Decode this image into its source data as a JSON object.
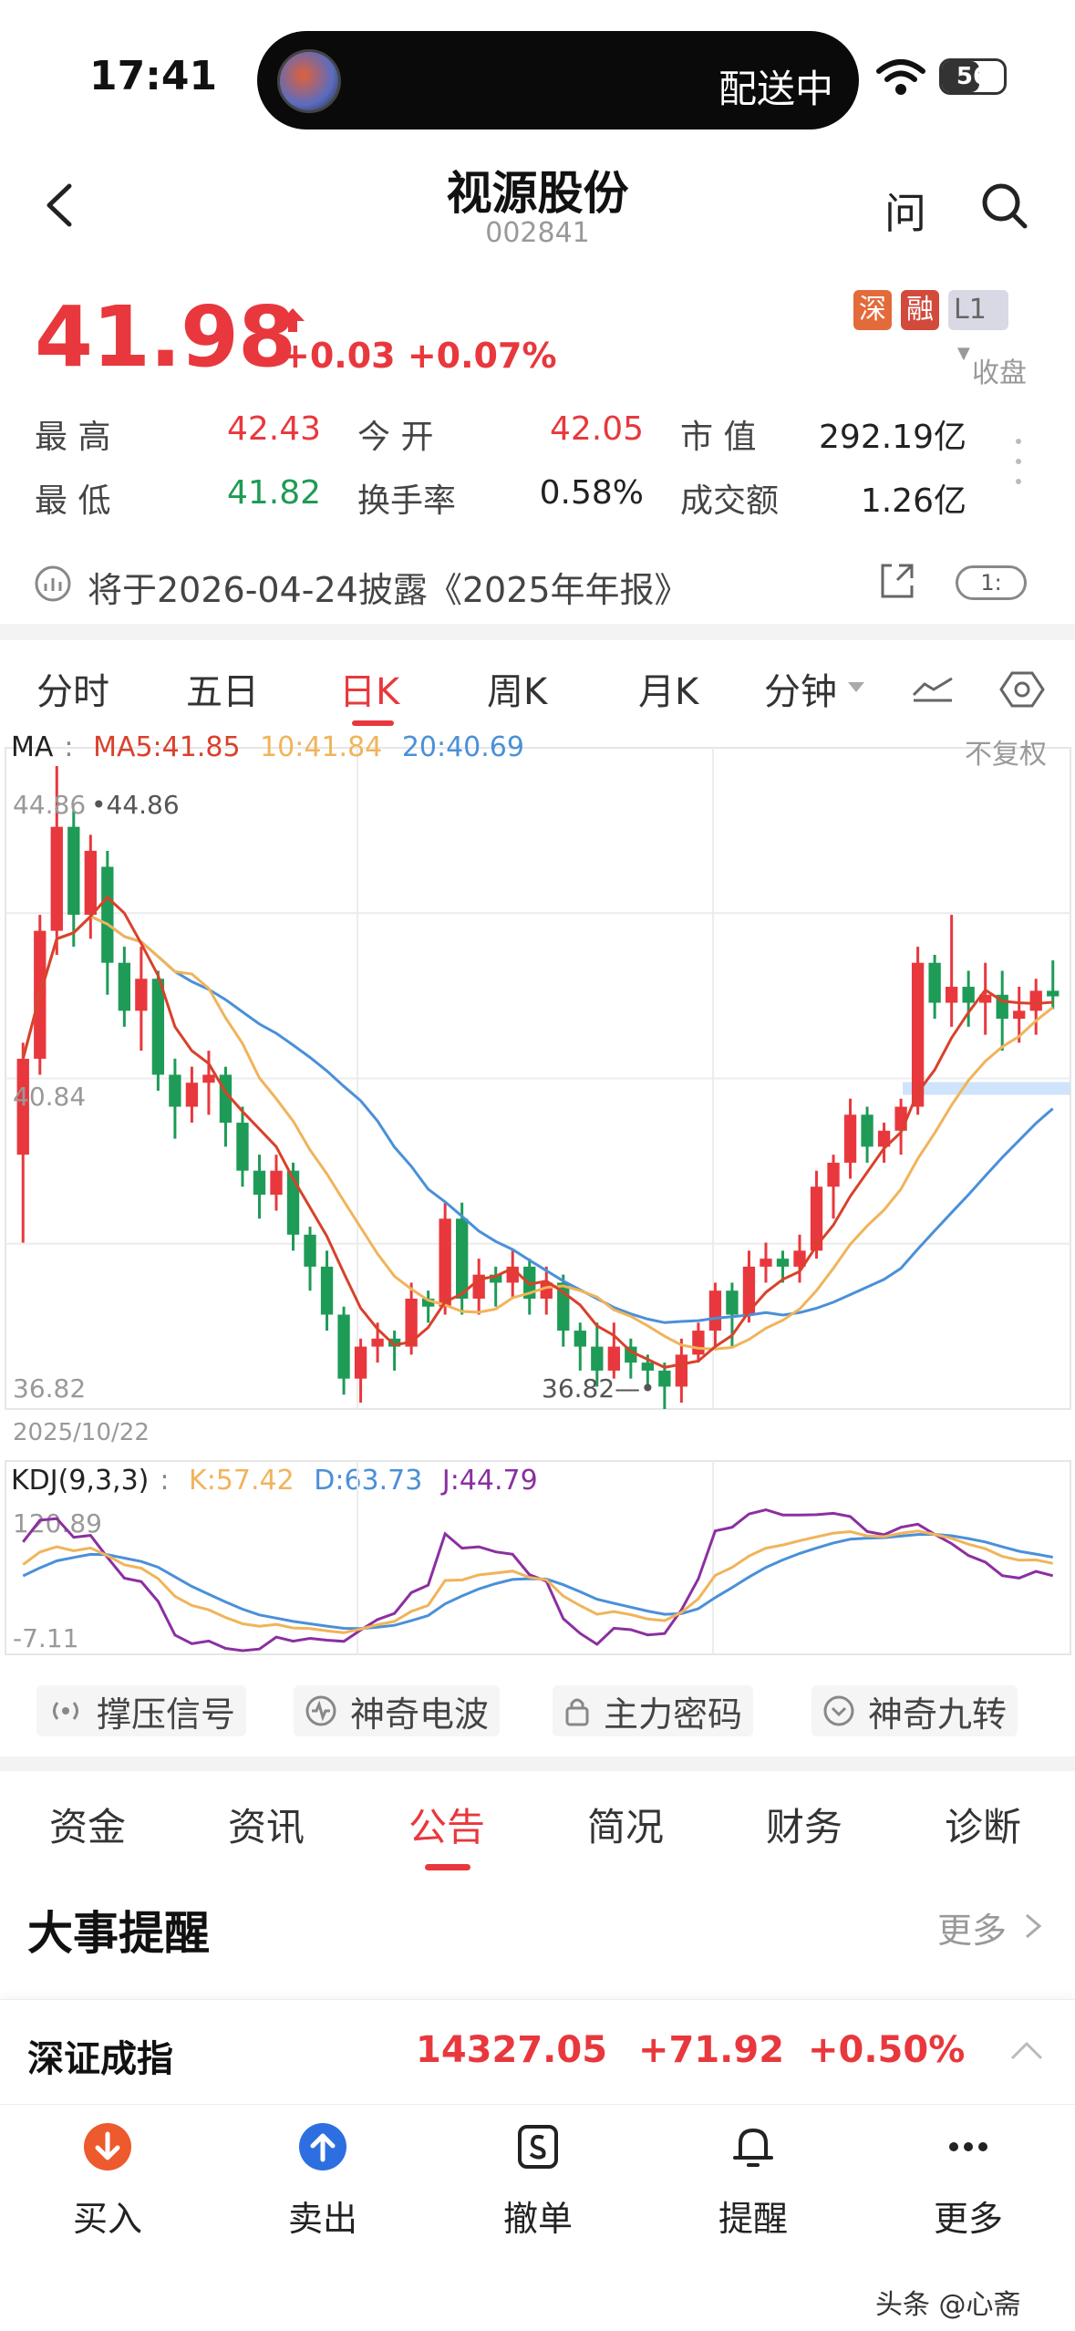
{
  "status": {
    "time": "17:41",
    "island_text": "配送中",
    "battery": "56"
  },
  "header": {
    "title": "视源股份",
    "code": "002841",
    "ask": "问"
  },
  "quote": {
    "price": "41.98",
    "change": "+0.03",
    "change_pct": "+0.07%",
    "tags": [
      "深",
      "融",
      "L1"
    ],
    "status": "收盘"
  },
  "stats": {
    "high_label": "最  高",
    "high": "42.43",
    "open_label": "今  开",
    "open": "42.05",
    "mcap_label": "市  值",
    "mcap": "292.19亿",
    "low_label": "最  低",
    "low": "41.82",
    "turnover_label": "换手率",
    "turnover": "0.58%",
    "amount_label": "成交额",
    "amount": "1.26亿"
  },
  "notice": {
    "text": "将于2026-04-24披露《2025年年报》",
    "badge": "1:"
  },
  "chart_tabs": [
    "分时",
    "五日",
    "日K",
    "周K",
    "月K",
    "分钟"
  ],
  "ma": {
    "label": "MA",
    "ma5": "MA5:41.85",
    "ma10": "10:41.84",
    "ma20": "20:40.69",
    "adjust": "不复权"
  },
  "axis": {
    "top": "44.86",
    "mid": "40.84",
    "bottom": "36.82",
    "max_mark": "44.86",
    "min_mark": "36.82"
  },
  "date": "2025/10/22",
  "kdj": {
    "label": "KDJ(9,3,3)",
    "k": "K:57.42",
    "d": "D:63.73",
    "j": "J:44.79",
    "top": "120.89",
    "bottom": "-7.11"
  },
  "indicators": [
    "撑压信号",
    "神奇电波",
    "主力密码",
    "神奇九转"
  ],
  "bottom_tabs": [
    "资金",
    "资讯",
    "公告",
    "简况",
    "财务",
    "诊断"
  ],
  "events": {
    "title": "大事提醒",
    "more": "更多"
  },
  "index": {
    "name": "深证成指",
    "value": "14327.05",
    "change": "+71.92",
    "pct": "+0.50%"
  },
  "nav": [
    "买入",
    "卖出",
    "撤单",
    "提醒",
    "更多"
  ],
  "watermark": "头条 @心斋",
  "colors": {
    "up": "#e8383d",
    "down": "#1e9b56",
    "ma5": "#d9412b",
    "ma10": "#f0b45a",
    "ma20": "#4a90d9",
    "kdj_j": "#8b2fa0"
  },
  "chart_data": {
    "type": "candlestick",
    "ylim": [
      36.82,
      44.86
    ],
    "candles": [
      [
        40.0,
        41.2,
        38.9,
        41.4
      ],
      [
        41.2,
        42.8,
        41.0,
        43.0
      ],
      [
        42.8,
        44.1,
        42.5,
        44.86
      ],
      [
        44.1,
        43.0,
        42.6,
        44.3
      ],
      [
        43.0,
        43.8,
        42.7,
        44.0
      ],
      [
        43.6,
        42.4,
        42.0,
        43.8
      ],
      [
        42.4,
        41.8,
        41.6,
        42.6
      ],
      [
        41.8,
        42.2,
        41.3,
        42.6
      ],
      [
        42.2,
        41.0,
        40.8,
        42.3
      ],
      [
        41.0,
        40.6,
        40.2,
        41.2
      ],
      [
        40.6,
        40.9,
        40.4,
        41.1
      ],
      [
        40.9,
        41.0,
        40.5,
        41.3
      ],
      [
        41.0,
        40.4,
        40.1,
        41.1
      ],
      [
        40.4,
        39.8,
        39.6,
        40.6
      ],
      [
        39.8,
        39.5,
        39.2,
        40.0
      ],
      [
        39.5,
        39.8,
        39.3,
        40.0
      ],
      [
        39.8,
        39.0,
        38.8,
        39.9
      ],
      [
        39.0,
        38.6,
        38.3,
        39.1
      ],
      [
        38.6,
        38.0,
        37.8,
        38.8
      ],
      [
        38.0,
        37.2,
        37.0,
        38.1
      ],
      [
        37.2,
        37.6,
        36.9,
        37.7
      ],
      [
        37.6,
        37.7,
        37.4,
        37.9
      ],
      [
        37.7,
        37.6,
        37.3,
        37.8
      ],
      [
        37.6,
        38.2,
        37.5,
        38.4
      ],
      [
        38.2,
        38.1,
        37.9,
        38.3
      ],
      [
        38.1,
        39.2,
        38.0,
        39.4
      ],
      [
        39.2,
        38.2,
        38.0,
        39.4
      ],
      [
        38.2,
        38.5,
        38.0,
        38.7
      ],
      [
        38.5,
        38.4,
        38.1,
        38.6
      ],
      [
        38.4,
        38.6,
        38.2,
        38.8
      ],
      [
        38.6,
        38.2,
        38.0,
        38.7
      ],
      [
        38.2,
        38.4,
        38.0,
        38.6
      ],
      [
        38.4,
        37.8,
        37.6,
        38.5
      ],
      [
        37.8,
        37.6,
        37.3,
        37.9
      ],
      [
        37.6,
        37.3,
        37.1,
        37.9
      ],
      [
        37.3,
        37.6,
        37.2,
        37.9
      ],
      [
        37.6,
        37.4,
        37.2,
        37.7
      ],
      [
        37.4,
        37.3,
        37.1,
        37.5
      ],
      [
        37.3,
        37.1,
        36.82,
        37.4
      ],
      [
        37.1,
        37.5,
        36.9,
        37.7
      ],
      [
        37.5,
        37.8,
        37.4,
        37.9
      ],
      [
        37.8,
        38.3,
        37.6,
        38.4
      ],
      [
        38.3,
        38.0,
        37.6,
        38.4
      ],
      [
        38.0,
        38.6,
        37.9,
        38.8
      ],
      [
        38.6,
        38.7,
        38.4,
        38.9
      ],
      [
        38.7,
        38.6,
        38.4,
        38.8
      ],
      [
        38.6,
        38.8,
        38.4,
        39.0
      ],
      [
        38.8,
        39.6,
        38.7,
        39.8
      ],
      [
        39.6,
        39.9,
        39.2,
        40.0
      ],
      [
        39.9,
        40.5,
        39.7,
        40.7
      ],
      [
        40.5,
        40.1,
        39.9,
        40.6
      ],
      [
        40.1,
        40.3,
        39.9,
        40.4
      ],
      [
        40.3,
        40.6,
        40.0,
        40.7
      ],
      [
        40.6,
        42.4,
        40.5,
        42.6
      ],
      [
        42.4,
        41.9,
        41.7,
        42.5
      ],
      [
        41.9,
        42.1,
        41.6,
        43.0
      ],
      [
        42.1,
        41.9,
        41.6,
        42.3
      ],
      [
        41.9,
        42.0,
        41.5,
        42.4
      ],
      [
        42.0,
        41.7,
        41.3,
        42.3
      ],
      [
        41.7,
        41.8,
        41.4,
        42.1
      ],
      [
        41.8,
        42.05,
        41.5,
        42.2
      ],
      [
        42.05,
        41.98,
        41.82,
        42.43
      ]
    ],
    "kdj_ylim": [
      -7.11,
      120.89
    ]
  }
}
